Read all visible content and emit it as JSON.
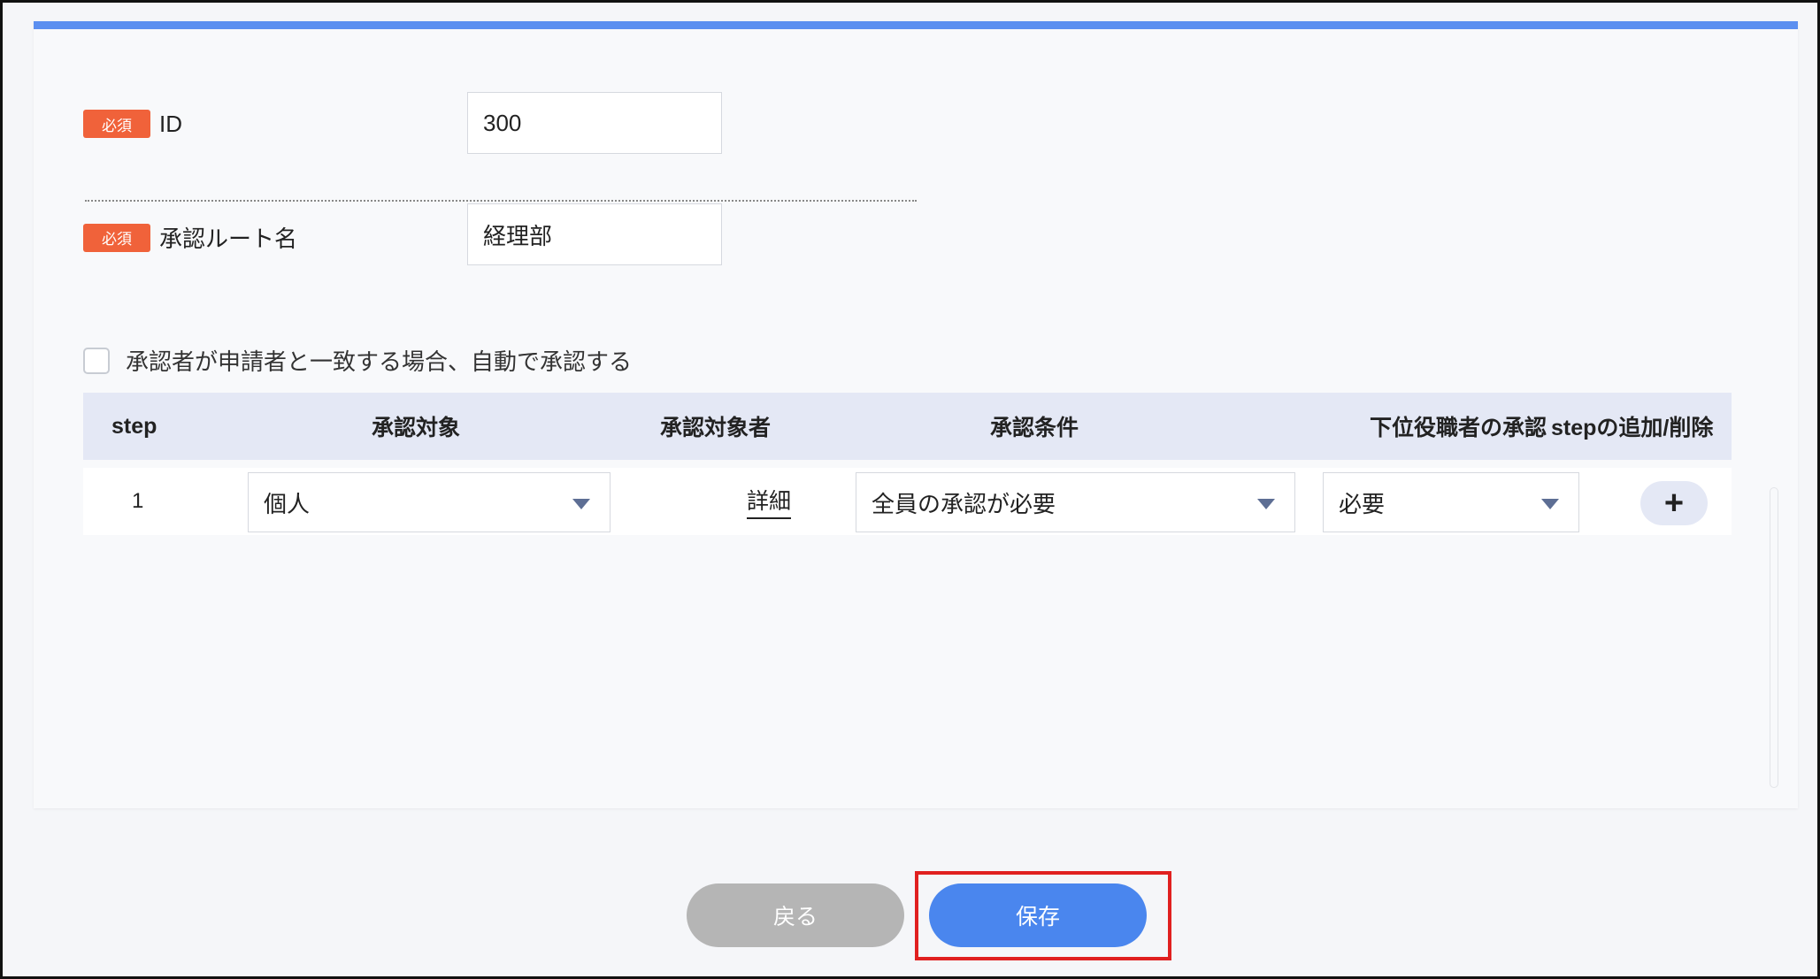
{
  "form": {
    "id_field": {
      "badge": "必須",
      "label": "ID",
      "value": "300"
    },
    "route_name_field": {
      "badge": "必須",
      "label": "承認ルート名",
      "value": "経理部"
    },
    "auto_approve_checkbox": {
      "label": "承認者が申請者と一致する場合、自動で承認する",
      "checked": false
    }
  },
  "table": {
    "headers": {
      "step": "step",
      "target": "承認対象",
      "target_person": "承認対象者",
      "condition": "承認条件",
      "subordinate": "下位役職者の承認",
      "add_remove": "stepの追加/削除"
    },
    "rows": [
      {
        "step": "1",
        "target": "個人",
        "target_person_link": "詳細",
        "condition": "全員の承認が必要",
        "subordinate": "必要",
        "add_icon": "+"
      }
    ]
  },
  "footer": {
    "back_label": "戻る",
    "save_label": "保存"
  },
  "colors": {
    "accent": "#5b8ff0",
    "required_badge": "#f0623a",
    "save_button": "#4a86ee",
    "back_button": "#b5b5b5",
    "highlight": "#e02020"
  },
  "icons": {
    "dropdown": "chevron-down-icon",
    "add": "plus-icon"
  }
}
